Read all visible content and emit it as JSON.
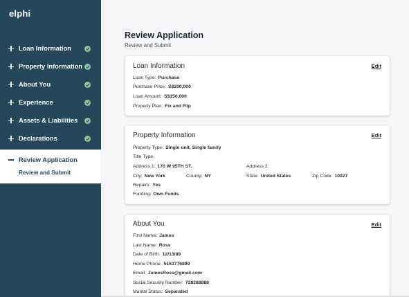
{
  "app": {
    "logo": "elphi"
  },
  "sidebar": {
    "items": [
      {
        "label": "Loan Information"
      },
      {
        "label": "Property Information"
      },
      {
        "label": "About You"
      },
      {
        "label": "Experience"
      },
      {
        "label": "Assets & Liabilities"
      },
      {
        "label": "Declarations"
      }
    ],
    "active": {
      "label": "Review Application",
      "sub": "Review and Submit"
    }
  },
  "main": {
    "title": "Review Application",
    "subtitle": "Review and Submit"
  },
  "edit_label": "Edit",
  "loan": {
    "title": "Loan Information",
    "loan_type": {
      "k": "Loan Type:",
      "v": "Purchase"
    },
    "purchase_price": {
      "k": "Purchase Price:",
      "v": "S$200,000"
    },
    "loan_amount": {
      "k": "Loan Amount:",
      "v": "S$150,000"
    },
    "property_plan": {
      "k": "Property Plan:",
      "v": "Fix and Flip"
    }
  },
  "property": {
    "title": "Property Information",
    "property_type": {
      "k": "Property Type:",
      "v": "Single unit, Single family"
    },
    "title_type": {
      "k": "Title Type:",
      "v": ""
    },
    "address1": {
      "k": "Address 1:",
      "v": "170 W 95TH ST."
    },
    "address2": {
      "k": "Address 2:",
      "v": ""
    },
    "city": {
      "k": "City:",
      "v": "New York"
    },
    "county": {
      "k": "County:",
      "v": "NY"
    },
    "state": {
      "k": "State:",
      "v": "United States"
    },
    "zip": {
      "k": "Zip Code:",
      "v": "10027"
    },
    "repairs": {
      "k": "Repairs:",
      "v": "Yes"
    },
    "funding": {
      "k": "Funding:",
      "v": "Own Funds"
    }
  },
  "about": {
    "title": "About You",
    "first_name": {
      "k": "First Name:",
      "v": "James"
    },
    "last_name": {
      "k": "Last Name:",
      "v": "Ross"
    },
    "dob": {
      "k": "Date of Birth:",
      "v": "12/13/89"
    },
    "home_phone": {
      "k": "Home Phone:",
      "v": "5163776899"
    },
    "email": {
      "k": "Email:",
      "v": "JamesRoss@gmail.com"
    },
    "ssn": {
      "k": "Social Security Number:",
      "v": "728288888"
    },
    "marital": {
      "k": "Marital Status:",
      "v": "Separated"
    }
  },
  "colors": {
    "sidebar": "#24485a",
    "check": "#8fc99b",
    "background": "#f6f6f8"
  },
  "icons": {
    "nav": "plus-icon",
    "complete": "check-circle-icon",
    "active": "minus-icon"
  }
}
